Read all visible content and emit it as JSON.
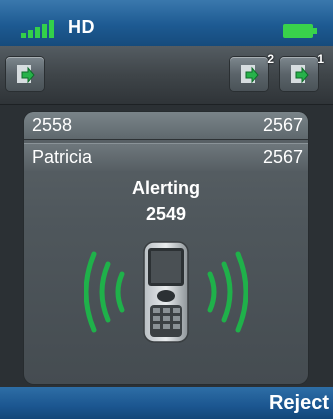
{
  "status_bar": {
    "signal_icon": "signal-bars-icon",
    "network_label": "HD",
    "battery_icon": "battery-icon",
    "colors": {
      "signal": "#33d04a",
      "battery": "#39d24b"
    }
  },
  "toolbar": {
    "left_button_icon": "transfer-call-icon",
    "right_buttons": [
      {
        "icon": "transfer-call-icon",
        "badge": "2"
      },
      {
        "icon": "transfer-call-icon",
        "badge": "1"
      }
    ]
  },
  "call_panel": {
    "line1": {
      "label": "2558",
      "value": "2567"
    },
    "line2": {
      "label": "Patricia",
      "value": "2567"
    },
    "state": "Alerting",
    "number": "2549",
    "illustration_icon": "ringing-phone-icon",
    "wave_color": "#1fb14a"
  },
  "softkeys": {
    "right": "Reject"
  }
}
